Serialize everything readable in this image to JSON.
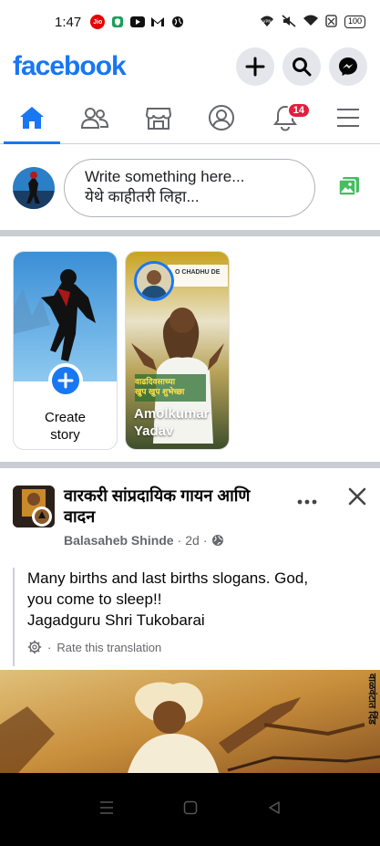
{
  "status_bar": {
    "time": "1:47",
    "carrier_icon": "Jio",
    "battery": "100",
    "left_icons": [
      "jio-icon",
      "shield-icon",
      "youtube-icon",
      "gmail-icon",
      "globe-icon"
    ],
    "right_icons": [
      "vpn-icon",
      "mute-icon",
      "wifi-icon",
      "no-sim-icon",
      "battery-icon"
    ]
  },
  "header": {
    "logo": "facebook",
    "brand_color": "#1877f2",
    "actions": [
      "plus-icon",
      "search-icon",
      "messenger-icon"
    ]
  },
  "nav": {
    "tabs": [
      "home-icon",
      "friends-icon",
      "marketplace-icon",
      "profile-icon",
      "notifications-icon",
      "menu-icon"
    ],
    "active": "home",
    "notifications_badge": "14"
  },
  "composer": {
    "placeholder_line1": "Write something here...",
    "placeholder_line2": "येथे काहीतरी लिहा..."
  },
  "stories": {
    "create_label_line1": "Create",
    "create_label_line2": "story",
    "user_story_name_line1": "Amolkumar",
    "user_story_name_line2": "Yadav",
    "user_story_banner": "O CHADHU DE",
    "user_story_caption1": "वाढदिवसाच्या",
    "user_story_caption2": "खुप खुप शुभेच्छा"
  },
  "post": {
    "page_name": "वारकरी सांप्रदायिक गायन आणि वादन",
    "author": "Balasaheb Shinde",
    "time": "2d",
    "separator": "·",
    "text_line1": "Many births and last births slogans. God,",
    "text_line2": "you come to sleep!!",
    "text_line3": "Jagadguru Shri Tukobarai",
    "translate_label": "Rate this translation",
    "image_caption": "वाळवंटात दिंड"
  }
}
